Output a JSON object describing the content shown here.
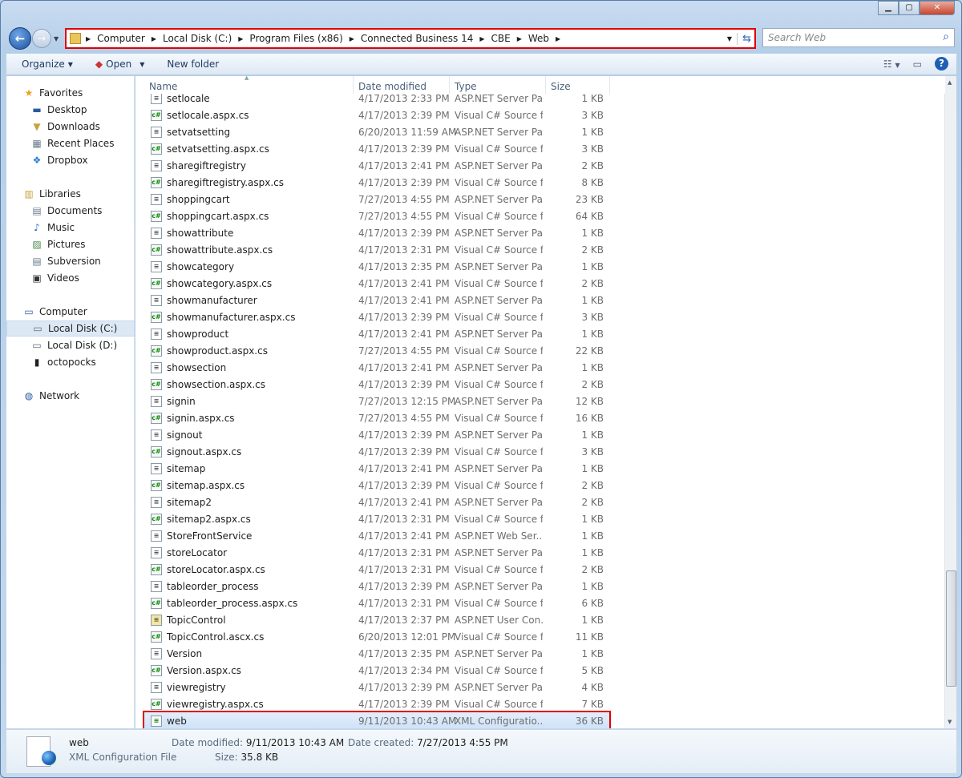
{
  "breadcrumb": [
    "Computer",
    "Local Disk (C:)",
    "Program Files (x86)",
    "Connected Business 14",
    "CBE",
    "Web"
  ],
  "search": {
    "placeholder": "Search Web"
  },
  "toolbar": {
    "organize": "Organize",
    "open": "Open",
    "new_folder": "New folder"
  },
  "sidebar": {
    "favorites": {
      "label": "Favorites",
      "items": [
        "Desktop",
        "Downloads",
        "Recent Places",
        "Dropbox"
      ]
    },
    "libraries": {
      "label": "Libraries",
      "items": [
        "Documents",
        "Music",
        "Pictures",
        "Subversion",
        "Videos"
      ]
    },
    "computer": {
      "label": "Computer",
      "items": [
        "Local Disk (C:)",
        "Local Disk (D:)",
        "octopocks"
      ],
      "selected": "Local Disk (C:)"
    },
    "network": {
      "label": "Network"
    }
  },
  "columns": [
    "Name",
    "Date modified",
    "Type",
    "Size"
  ],
  "files": [
    [
      "setlocale",
      "4/17/2013 2:33 PM",
      "ASP.NET Server Pa...",
      "1 KB",
      "asp"
    ],
    [
      "setlocale.aspx.cs",
      "4/17/2013 2:39 PM",
      "Visual C# Source f...",
      "3 KB",
      "cs"
    ],
    [
      "setvatsetting",
      "6/20/2013 11:59 AM",
      "ASP.NET Server Pa...",
      "1 KB",
      "asp"
    ],
    [
      "setvatsetting.aspx.cs",
      "4/17/2013 2:39 PM",
      "Visual C# Source f...",
      "3 KB",
      "cs"
    ],
    [
      "sharegiftregistry",
      "4/17/2013 2:41 PM",
      "ASP.NET Server Pa...",
      "2 KB",
      "asp"
    ],
    [
      "sharegiftregistry.aspx.cs",
      "4/17/2013 2:39 PM",
      "Visual C# Source f...",
      "8 KB",
      "cs"
    ],
    [
      "shoppingcart",
      "7/27/2013 4:55 PM",
      "ASP.NET Server Pa...",
      "23 KB",
      "asp"
    ],
    [
      "shoppingcart.aspx.cs",
      "7/27/2013 4:55 PM",
      "Visual C# Source f...",
      "64 KB",
      "cs"
    ],
    [
      "showattribute",
      "4/17/2013 2:39 PM",
      "ASP.NET Server Pa...",
      "1 KB",
      "asp"
    ],
    [
      "showattribute.aspx.cs",
      "4/17/2013 2:31 PM",
      "Visual C# Source f...",
      "2 KB",
      "cs"
    ],
    [
      "showcategory",
      "4/17/2013 2:35 PM",
      "ASP.NET Server Pa...",
      "1 KB",
      "asp"
    ],
    [
      "showcategory.aspx.cs",
      "4/17/2013 2:41 PM",
      "Visual C# Source f...",
      "2 KB",
      "cs"
    ],
    [
      "showmanufacturer",
      "4/17/2013 2:41 PM",
      "ASP.NET Server Pa...",
      "1 KB",
      "asp"
    ],
    [
      "showmanufacturer.aspx.cs",
      "4/17/2013 2:39 PM",
      "Visual C# Source f...",
      "3 KB",
      "cs"
    ],
    [
      "showproduct",
      "4/17/2013 2:41 PM",
      "ASP.NET Server Pa...",
      "1 KB",
      "asp"
    ],
    [
      "showproduct.aspx.cs",
      "7/27/2013 4:55 PM",
      "Visual C# Source f...",
      "22 KB",
      "cs"
    ],
    [
      "showsection",
      "4/17/2013 2:41 PM",
      "ASP.NET Server Pa...",
      "1 KB",
      "asp"
    ],
    [
      "showsection.aspx.cs",
      "4/17/2013 2:39 PM",
      "Visual C# Source f...",
      "2 KB",
      "cs"
    ],
    [
      "signin",
      "7/27/2013 12:15 PM",
      "ASP.NET Server Pa...",
      "12 KB",
      "asp"
    ],
    [
      "signin.aspx.cs",
      "7/27/2013 4:55 PM",
      "Visual C# Source f...",
      "16 KB",
      "cs"
    ],
    [
      "signout",
      "4/17/2013 2:39 PM",
      "ASP.NET Server Pa...",
      "1 KB",
      "asp"
    ],
    [
      "signout.aspx.cs",
      "4/17/2013 2:39 PM",
      "Visual C# Source f...",
      "3 KB",
      "cs"
    ],
    [
      "sitemap",
      "4/17/2013 2:41 PM",
      "ASP.NET Server Pa...",
      "1 KB",
      "asp"
    ],
    [
      "sitemap.aspx.cs",
      "4/17/2013 2:39 PM",
      "Visual C# Source f...",
      "2 KB",
      "cs"
    ],
    [
      "sitemap2",
      "4/17/2013 2:41 PM",
      "ASP.NET Server Pa...",
      "2 KB",
      "asp"
    ],
    [
      "sitemap2.aspx.cs",
      "4/17/2013 2:31 PM",
      "Visual C# Source f...",
      "1 KB",
      "cs"
    ],
    [
      "StoreFrontService",
      "4/17/2013 2:41 PM",
      "ASP.NET Web Ser...",
      "1 KB",
      "asp"
    ],
    [
      "storeLocator",
      "4/17/2013 2:31 PM",
      "ASP.NET Server Pa...",
      "1 KB",
      "asp"
    ],
    [
      "storeLocator.aspx.cs",
      "4/17/2013 2:31 PM",
      "Visual C# Source f...",
      "2 KB",
      "cs"
    ],
    [
      "tableorder_process",
      "4/17/2013 2:39 PM",
      "ASP.NET Server Pa...",
      "1 KB",
      "asp"
    ],
    [
      "tableorder_process.aspx.cs",
      "4/17/2013 2:31 PM",
      "Visual C# Source f...",
      "6 KB",
      "cs"
    ],
    [
      "TopicControl",
      "4/17/2013 2:37 PM",
      "ASP.NET User Con...",
      "1 KB",
      "ctl"
    ],
    [
      "TopicControl.ascx.cs",
      "6/20/2013 12:01 PM",
      "Visual C# Source f...",
      "11 KB",
      "cs"
    ],
    [
      "Version",
      "4/17/2013 2:35 PM",
      "ASP.NET Server Pa...",
      "1 KB",
      "asp"
    ],
    [
      "Version.aspx.cs",
      "4/17/2013 2:34 PM",
      "Visual C# Source f...",
      "5 KB",
      "cs"
    ],
    [
      "viewregistry",
      "4/17/2013 2:39 PM",
      "ASP.NET Server Pa...",
      "4 KB",
      "asp"
    ],
    [
      "viewregistry.aspx.cs",
      "4/17/2013 2:39 PM",
      "Visual C# Source f...",
      "7 KB",
      "cs"
    ],
    [
      "web",
      "9/11/2013 10:43 AM",
      "XML Configuratio...",
      "36 KB",
      "xml"
    ]
  ],
  "selected_file": "web",
  "details": {
    "name": "web",
    "type": "XML Configuration File",
    "modified_label": "Date modified:",
    "modified": "9/11/2013 10:43 AM",
    "created_label": "Date created:",
    "created": "7/27/2013 4:55 PM",
    "size_label": "Size:",
    "size": "35.8 KB"
  },
  "colors": {
    "highlight": "#e00000",
    "selection": "#cfe2f8"
  }
}
